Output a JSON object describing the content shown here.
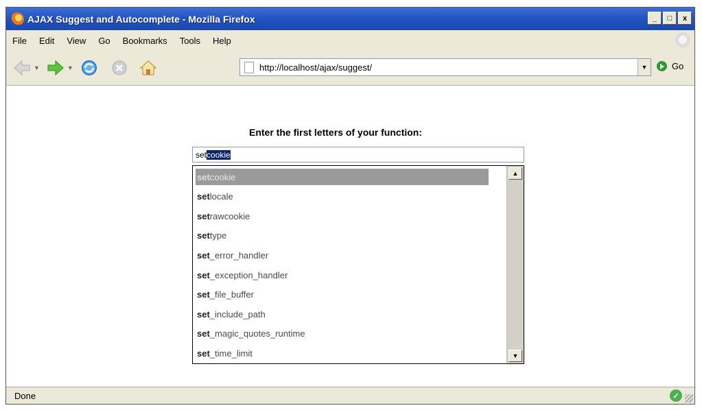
{
  "window": {
    "title": "AJAX Suggest and Autocomplete - Mozilla Firefox"
  },
  "window_buttons": {
    "minimize": "_",
    "maximize": "□",
    "close": "x"
  },
  "menu": [
    {
      "label": "File"
    },
    {
      "label": "Edit"
    },
    {
      "label": "View"
    },
    {
      "label": "Go"
    },
    {
      "label": "Bookmarks"
    },
    {
      "label": "Tools"
    },
    {
      "label": "Help"
    }
  ],
  "nav": {
    "url": "http://localhost/ajax/suggest/",
    "go_label": "Go"
  },
  "page": {
    "prompt": "Enter the first letters of your function:",
    "input_typed": "set",
    "input_selected": "cookie"
  },
  "suggestions": [
    {
      "prefix": "set",
      "rest": "cookie",
      "active": true
    },
    {
      "prefix": "set",
      "rest": "locale",
      "active": false
    },
    {
      "prefix": "set",
      "rest": "rawcookie",
      "active": false
    },
    {
      "prefix": "set",
      "rest": "type",
      "active": false
    },
    {
      "prefix": "set",
      "rest": "_error_handler",
      "active": false
    },
    {
      "prefix": "set",
      "rest": "_exception_handler",
      "active": false
    },
    {
      "prefix": "set",
      "rest": "_file_buffer",
      "active": false
    },
    {
      "prefix": "set",
      "rest": "_include_path",
      "active": false
    },
    {
      "prefix": "set",
      "rest": "_magic_quotes_runtime",
      "active": false
    },
    {
      "prefix": "set",
      "rest": "_time_limit",
      "active": false
    }
  ],
  "status": {
    "text": "Done"
  },
  "colors": {
    "titlebar": "#2454c2",
    "selection": "#0a246a",
    "active_item": "#9a9a9a"
  }
}
